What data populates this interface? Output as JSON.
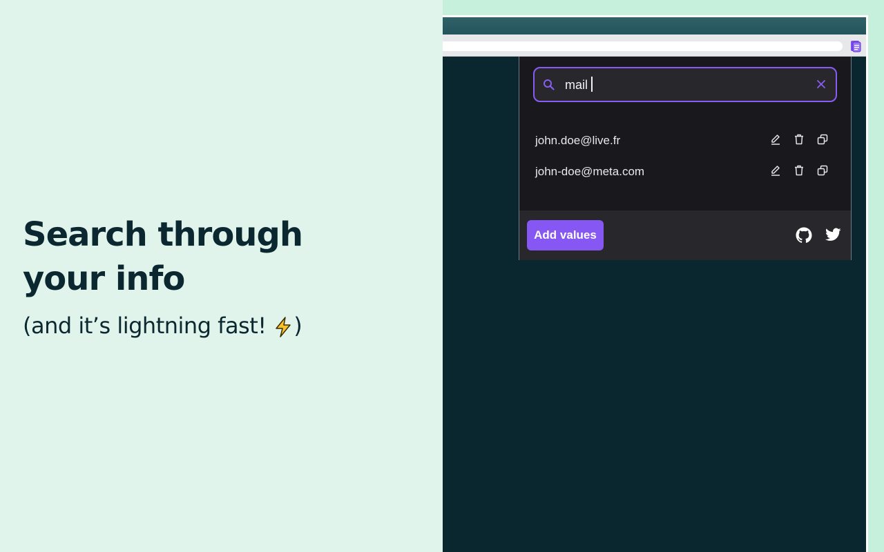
{
  "promo": {
    "headline_line1": "Search through",
    "headline_line2": "your info",
    "subline_before": "(and it’s lightning  fast! ",
    "subline_after": ")",
    "bolt_icon": "lightning-icon"
  },
  "browser": {
    "extension_icon": "document-icon"
  },
  "popup": {
    "search": {
      "value": "mail",
      "search_icon": "search-icon",
      "clear_label": "X"
    },
    "results": [
      {
        "text": "john.doe@live.fr"
      },
      {
        "text": "john-doe@meta.com"
      }
    ],
    "row_actions": [
      "edit-icon",
      "trash-icon",
      "copy-icon"
    ],
    "footer": {
      "add_label": "Add values",
      "links": [
        "github-icon",
        "twitter-icon"
      ]
    }
  },
  "colors": {
    "accent": "#8657f3",
    "popup_bg": "#18181d",
    "page_bg": "#0a2730",
    "promo_bg": "#e1f4ec",
    "headline": "#0b2730"
  }
}
